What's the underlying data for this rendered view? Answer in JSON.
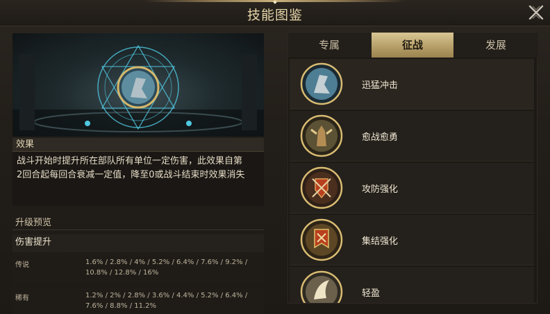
{
  "window": {
    "title": "技能图鉴",
    "close_icon": "close-x-icon"
  },
  "left": {
    "effect_label": "效果",
    "effect_text_line1": "战斗开始时提升所在部队所有单位一定伤害，此效果自第",
    "effect_text_line2": "2回合起每回合衰减一定值，降至0或战斗结束时效果消失",
    "preview_label": "升级预览",
    "boost_label": "伤害提升",
    "rarities": [
      {
        "label": "传说",
        "values": "1.6% / 2.8% / 4% / 5.2% / 6.4% / 7.6% / 9.2% / 10.8% / 12.8% / 16%"
      },
      {
        "label": "稀有",
        "values": "1.2% / 2% / 2.8% / 3.6% / 4.4% / 5.2% / 6.4% / 7.6% / 8.8% / 11.2%"
      }
    ]
  },
  "right": {
    "tabs": [
      "专属",
      "征战",
      "发展"
    ],
    "active_tab": "征战",
    "skills": [
      {
        "name": "迅猛冲击",
        "icon": "charging-knight-icon"
      },
      {
        "name": "愈战愈勇",
        "icon": "berserker-warrior-icon"
      },
      {
        "name": "攻防强化",
        "icon": "sword-shield-icon"
      },
      {
        "name": "集结强化",
        "icon": "banner-icon"
      },
      {
        "name": "轻盈",
        "icon": "wing-icon"
      }
    ]
  },
  "colors": {
    "accent_gold": "#c9b27c",
    "panel_dark": "#1c1915",
    "tab_active": "#b49c66",
    "rune_cyan": "#4fc7e0"
  }
}
